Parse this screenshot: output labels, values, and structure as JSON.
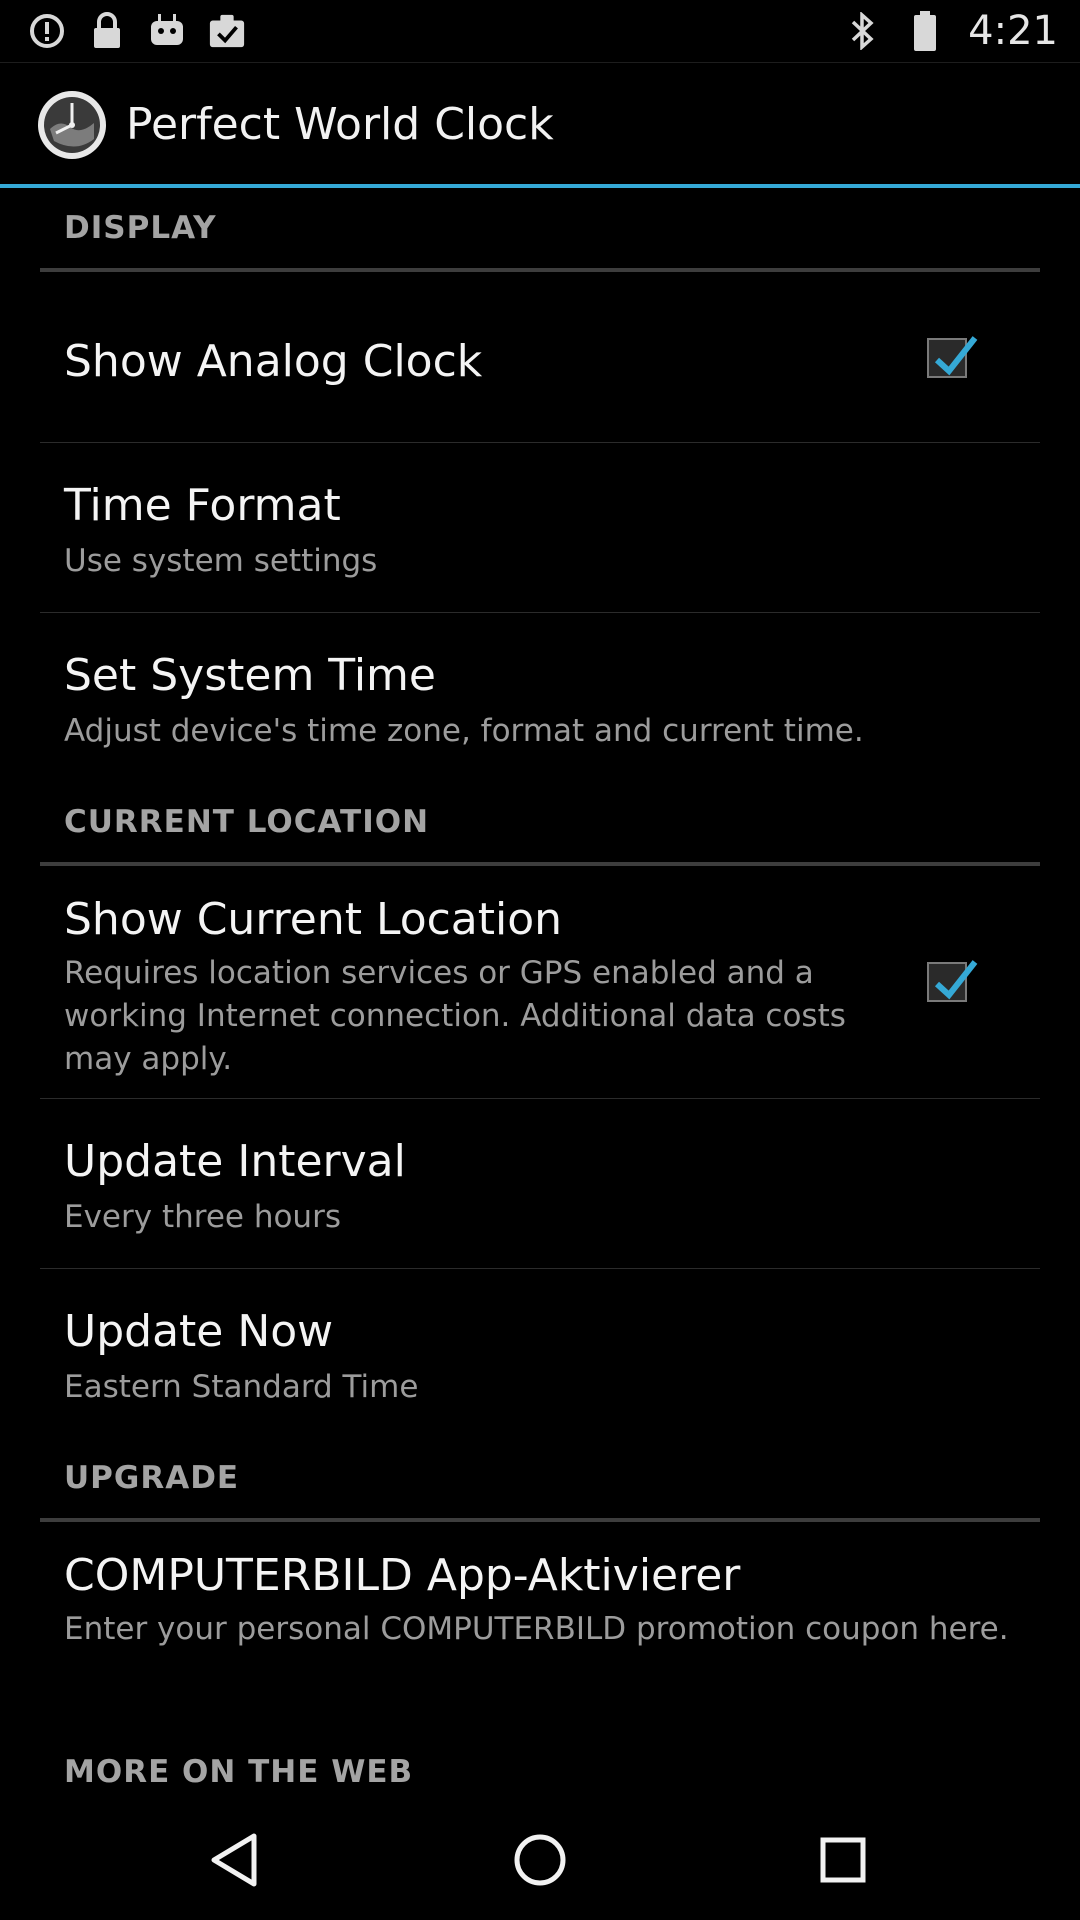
{
  "status_bar": {
    "icons": [
      "alert-circle-icon",
      "lock-icon",
      "android-robot-icon",
      "clipboard-check-icon",
      "bluetooth-icon",
      "battery-icon"
    ],
    "time": "4:21"
  },
  "action_bar": {
    "app_icon": "world-clock-icon",
    "title": "Perfect World Clock"
  },
  "sections": {
    "display": {
      "header": "DISPLAY",
      "show_analog_clock": {
        "title": "Show Analog Clock",
        "checked": true
      },
      "time_format": {
        "title": "Time Format",
        "summary": "Use system settings"
      },
      "set_system_time": {
        "title": "Set System Time",
        "summary": "Adjust device's time zone, format and current time."
      }
    },
    "current_location": {
      "header": "CURRENT LOCATION",
      "show_current_location": {
        "title": "Show Current Location",
        "summary": "Requires location services or GPS enabled and a working Internet connection. Additional data costs may apply.",
        "checked": true
      },
      "update_interval": {
        "title": "Update Interval",
        "summary": "Every three hours"
      },
      "update_now": {
        "title": "Update Now",
        "summary": "Eastern Standard Time"
      }
    },
    "upgrade": {
      "header": "UPGRADE",
      "computerbild": {
        "title": "COMPUTERBILD App-Aktivierer",
        "summary": "Enter your personal COMPUTERBILD promotion coupon here."
      }
    },
    "more_on_web": {
      "header": "MORE ON THE WEB"
    }
  },
  "nav_bar": {
    "back": "back-triangle-icon",
    "home": "home-circle-icon",
    "recents": "recents-square-icon"
  },
  "colors": {
    "accent": "#35a9d6",
    "check": "#35a9d6"
  }
}
